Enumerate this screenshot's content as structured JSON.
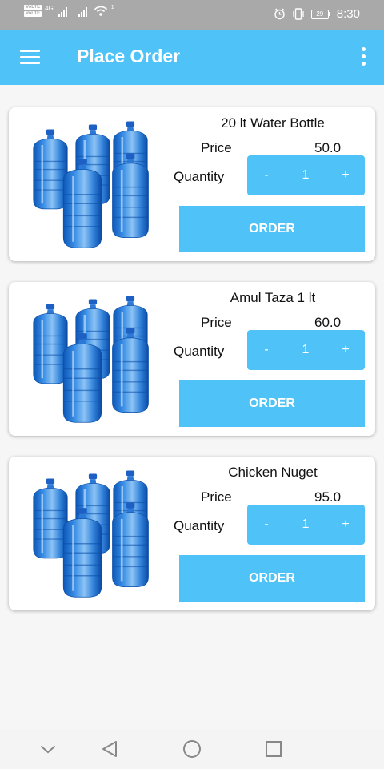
{
  "status_bar": {
    "time": "8:30",
    "battery": "29",
    "network_label": "4G",
    "volte_1": "VoLTE",
    "volte_2": "VoLTE",
    "wifi_badge": "1",
    "icons": [
      "volte-icon",
      "signal-icon",
      "wifi-icon",
      "alarm-icon",
      "vibrate-icon",
      "battery-icon"
    ]
  },
  "app_bar": {
    "title": "Place Order",
    "background": "#4fc3f7",
    "menu_icon": "hamburger-menu-icon",
    "overflow_icon": "more-vert-icon"
  },
  "labels": {
    "price": "Price",
    "quantity": "Quantity",
    "minus": "-",
    "plus": "+",
    "order": "ORDER"
  },
  "products": [
    {
      "name": "20 lt Water Bottle",
      "price": "50.0",
      "quantity": "1",
      "image": "water-bottles-image"
    },
    {
      "name": "Amul Taza 1 lt",
      "price": "60.0",
      "quantity": "1",
      "image": "water-bottles-image"
    },
    {
      "name": "Chicken Nuget",
      "price": "95.0",
      "quantity": "1",
      "image": "water-bottles-image"
    }
  ],
  "nav_bar": {
    "icons": [
      "collapse-chevron-icon",
      "back-icon",
      "home-icon",
      "recents-icon"
    ]
  }
}
